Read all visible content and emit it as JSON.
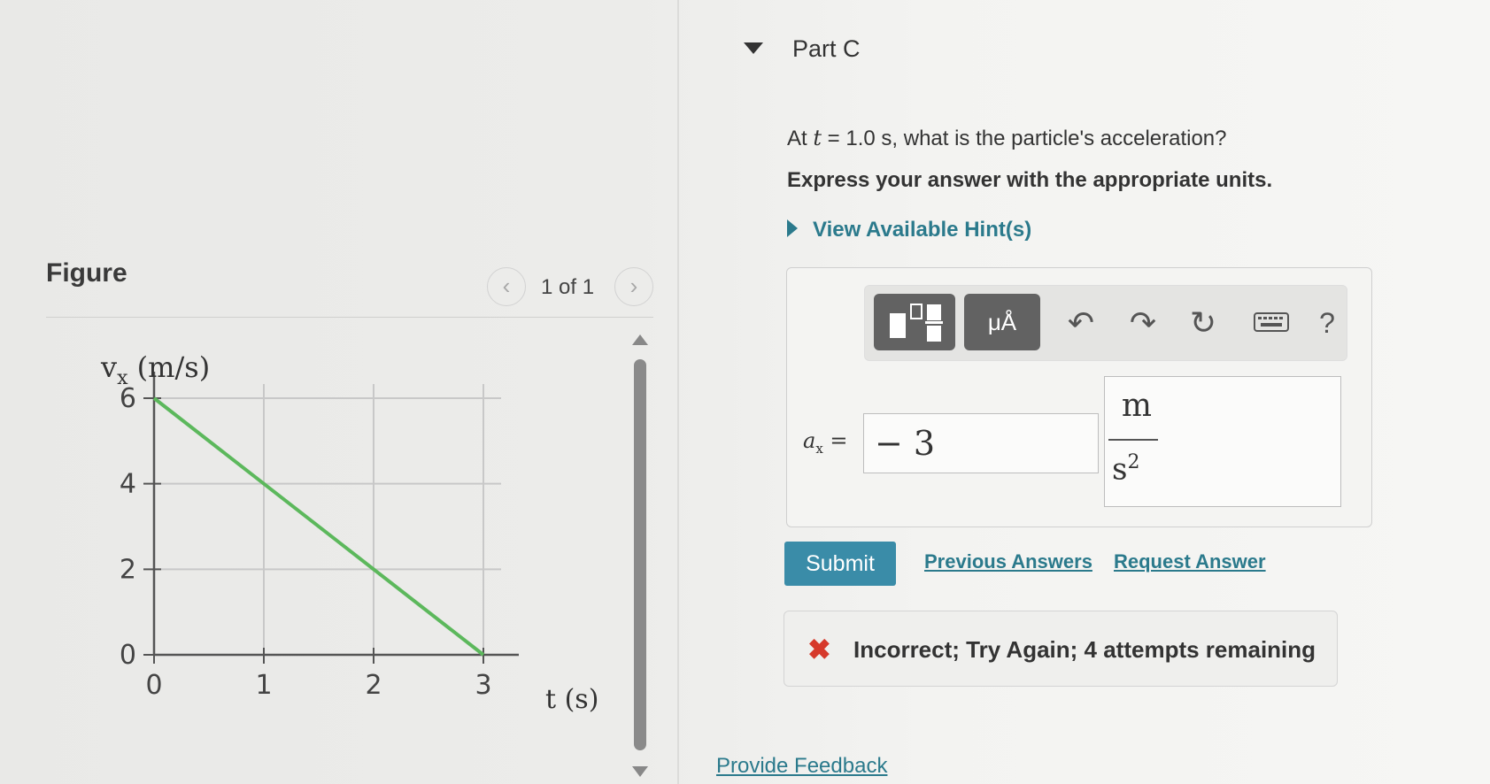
{
  "figure": {
    "title": "Figure",
    "page_indicator": "1 of 1",
    "prev_icon": "chevron-left-icon",
    "next_icon": "chevron-right-icon"
  },
  "chart_data": {
    "type": "line",
    "ylabel": "v_x (m/s)",
    "ylabel_parts": {
      "v": "v",
      "sub": "x",
      "units": " (m/s)"
    },
    "xlabel": "t (s)",
    "x_ticks": [
      "0",
      "1",
      "2",
      "3"
    ],
    "y_ticks": [
      "0",
      "2",
      "4",
      "6"
    ],
    "xlim": [
      0,
      3
    ],
    "ylim": [
      0,
      6
    ],
    "grid": true,
    "series": [
      {
        "x": [
          0,
          3
        ],
        "y": [
          6,
          0
        ],
        "color": "#5cb85c"
      }
    ]
  },
  "part": {
    "title": "Part C",
    "question_prefix": "At",
    "question_var": "t",
    "question_rest": " = 1.0 s, what is the particle's acceleration?",
    "instruction": "Express your answer with the appropriate units.",
    "hint_link": "View Available Hint(s)"
  },
  "toolbar": {
    "template_icon": "fraction-template-icon",
    "units_label": "μÅ",
    "undo_icon": "undo-icon",
    "redo_icon": "redo-icon",
    "reset_icon": "reset-icon",
    "keyboard_icon": "keyboard-icon",
    "help_label": "?"
  },
  "answer": {
    "variable_label": "a",
    "variable_sub": "x",
    "equals": "=",
    "value": "− 3",
    "unit_numerator": "m",
    "unit_denominator": "s",
    "unit_exponent": "2"
  },
  "actions": {
    "submit": "Submit",
    "previous_answers": "Previous Answers",
    "request_answer": "Request Answer"
  },
  "feedback": {
    "text": "Incorrect; Try Again; 4 attempts remaining",
    "status_color": "#d6392b"
  },
  "footer": {
    "provide_feedback": "Provide Feedback"
  }
}
